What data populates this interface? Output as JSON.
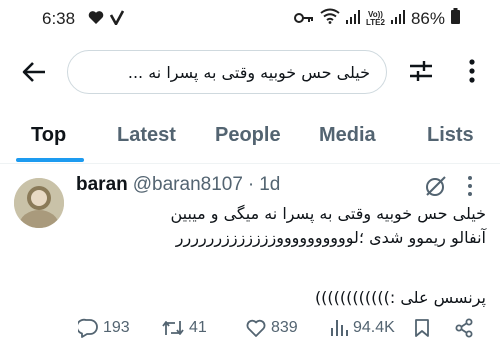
{
  "status_bar": {
    "time": "6:38",
    "battery_percent": "86%",
    "network_label_top": "Vo))",
    "network_label_bottom": "LTE2",
    "icons": [
      "heart-icon",
      "check-icon",
      "key-icon",
      "wifi-icon",
      "signal-icon",
      "battery-icon"
    ]
  },
  "search": {
    "query": "خیلی حس خوبیه وقتی به پسرا نه ..."
  },
  "tabs": [
    {
      "label": "Top",
      "active": true
    },
    {
      "label": "Latest",
      "active": false
    },
    {
      "label": "People",
      "active": false
    },
    {
      "label": "Media",
      "active": false
    },
    {
      "label": "Lists",
      "active": false
    }
  ],
  "tweet": {
    "display_name": "baran",
    "handle": "@baran8107",
    "separator": "·",
    "time": "1d",
    "text_lines": [
      "خیلی حس خوبیه وقتی به پسرا نه میگی و میبین",
      "آنفالو ریموو شدی ؛لووووووووووزززززززرررررر"
    ],
    "signature": "پرنسس علی :))))))))))))",
    "stats": {
      "replies": "193",
      "retweets": "41",
      "likes": "839",
      "views": "94.4K"
    }
  },
  "colors": {
    "accent": "#1d9bf0",
    "text_primary": "#0f1419",
    "text_secondary": "#536471",
    "border": "#cfd9de"
  }
}
